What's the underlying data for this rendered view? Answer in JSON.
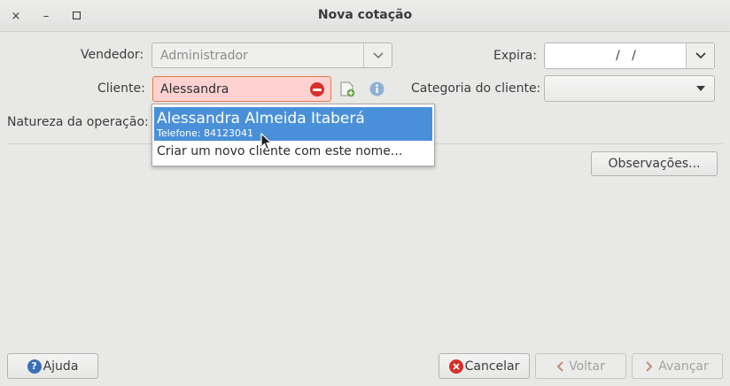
{
  "window": {
    "title": "Nova cotação",
    "close_glyph": "×",
    "minimize_glyph": "–",
    "maximize_glyph": "□"
  },
  "form": {
    "vendedor_label": "Vendedor:",
    "vendedor_value": "Administrador",
    "expira_label": "Expira:",
    "expira_value": "/   /",
    "cliente_label": "Cliente:",
    "cliente_value": "Alessandra",
    "categoria_label": "Categoria do cliente:",
    "categoria_value": "",
    "natureza_label": "Natureza da operação:"
  },
  "autocomplete": {
    "selected_name": "Alessandra Almeida Itaberá",
    "selected_phone": "Telefone: 84123041",
    "create_option": "Criar um novo cliente com este nome..."
  },
  "buttons": {
    "observacoes": "Observações...",
    "ajuda": "Ajuda",
    "cancelar": "Cancelar",
    "voltar": "Voltar",
    "avancar": "Avançar"
  },
  "icons": {
    "help": "help-icon",
    "cancel": "cancel-icon",
    "back": "chevron-left-icon",
    "forward": "chevron-right-icon",
    "add_client": "add-client-icon",
    "info": "info-icon",
    "clear": "clear-entry-icon"
  },
  "colors": {
    "selection": "#4a90d9",
    "error_entry_bg": "#ffd2d2",
    "error_entry_border": "#e07c42",
    "cancel_red": "#d6302a",
    "help_blue": "#3b6fb6"
  }
}
